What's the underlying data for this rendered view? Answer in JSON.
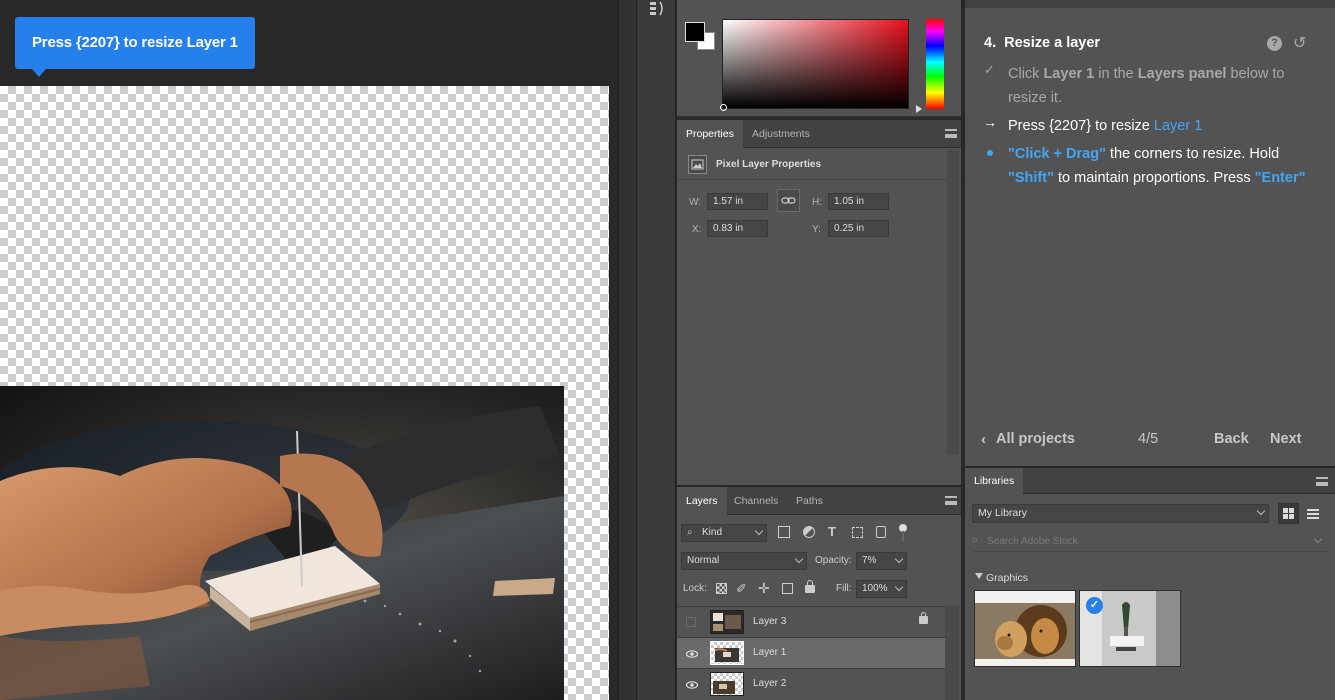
{
  "tooltip": {
    "text": "Press {2207} to resize Layer 1"
  },
  "color_panel": {
    "foreground": "#000000",
    "background": "#ffffff",
    "hue": "#e8101d"
  },
  "properties_panel": {
    "tabs": [
      "Properties",
      "Adjustments"
    ],
    "header": "Pixel Layer Properties",
    "w_label": "W:",
    "w_value": "1.57 in",
    "h_label": "H:",
    "h_value": "1.05 in",
    "x_label": "X:",
    "x_value": "0.83 in",
    "y_label": "Y:",
    "y_value": "0.25 in"
  },
  "layers_panel": {
    "tabs": [
      "Layers",
      "Channels",
      "Paths"
    ],
    "filter_kind": "Kind",
    "blend_mode": "Normal",
    "opacity_label": "Opacity:",
    "opacity_value": "7%",
    "lock_label": "Lock:",
    "fill_label": "Fill:",
    "fill_value": "100%",
    "layers": [
      {
        "name": "Layer 3",
        "visible": false,
        "locked": true
      },
      {
        "name": "Layer 1",
        "visible": true,
        "selected": true
      },
      {
        "name": "Layer 2",
        "visible": true
      }
    ]
  },
  "learn_panel": {
    "step_title": "4.  Resize a layer",
    "step1_pre": "Click ",
    "step1_layer": "Layer 1",
    "step1_mid": " in the ",
    "step1_panel": "Layers panel",
    "step1_post": " below to",
    "step1_line2": "resize it.",
    "step2_pre": "Press {2207} to resize ",
    "step2_layer": "Layer 1",
    "step3_hl1": "\"Click + Drag\"",
    "step3_mid": " the corners to resize. Hold",
    "step3_hl2": "\"Shift\"",
    "step3_mid2": " to maintain proportions. Press ",
    "step3_hl3": "\"Enter\"",
    "all_projects": "All projects",
    "progress": "4/5",
    "back": "Back",
    "next": "Next"
  },
  "libraries_panel": {
    "tab": "Libraries",
    "library": "My Library",
    "search_placeholder": "Search Adobe Stock",
    "section": "Graphics"
  },
  "accent": "#2680eb"
}
